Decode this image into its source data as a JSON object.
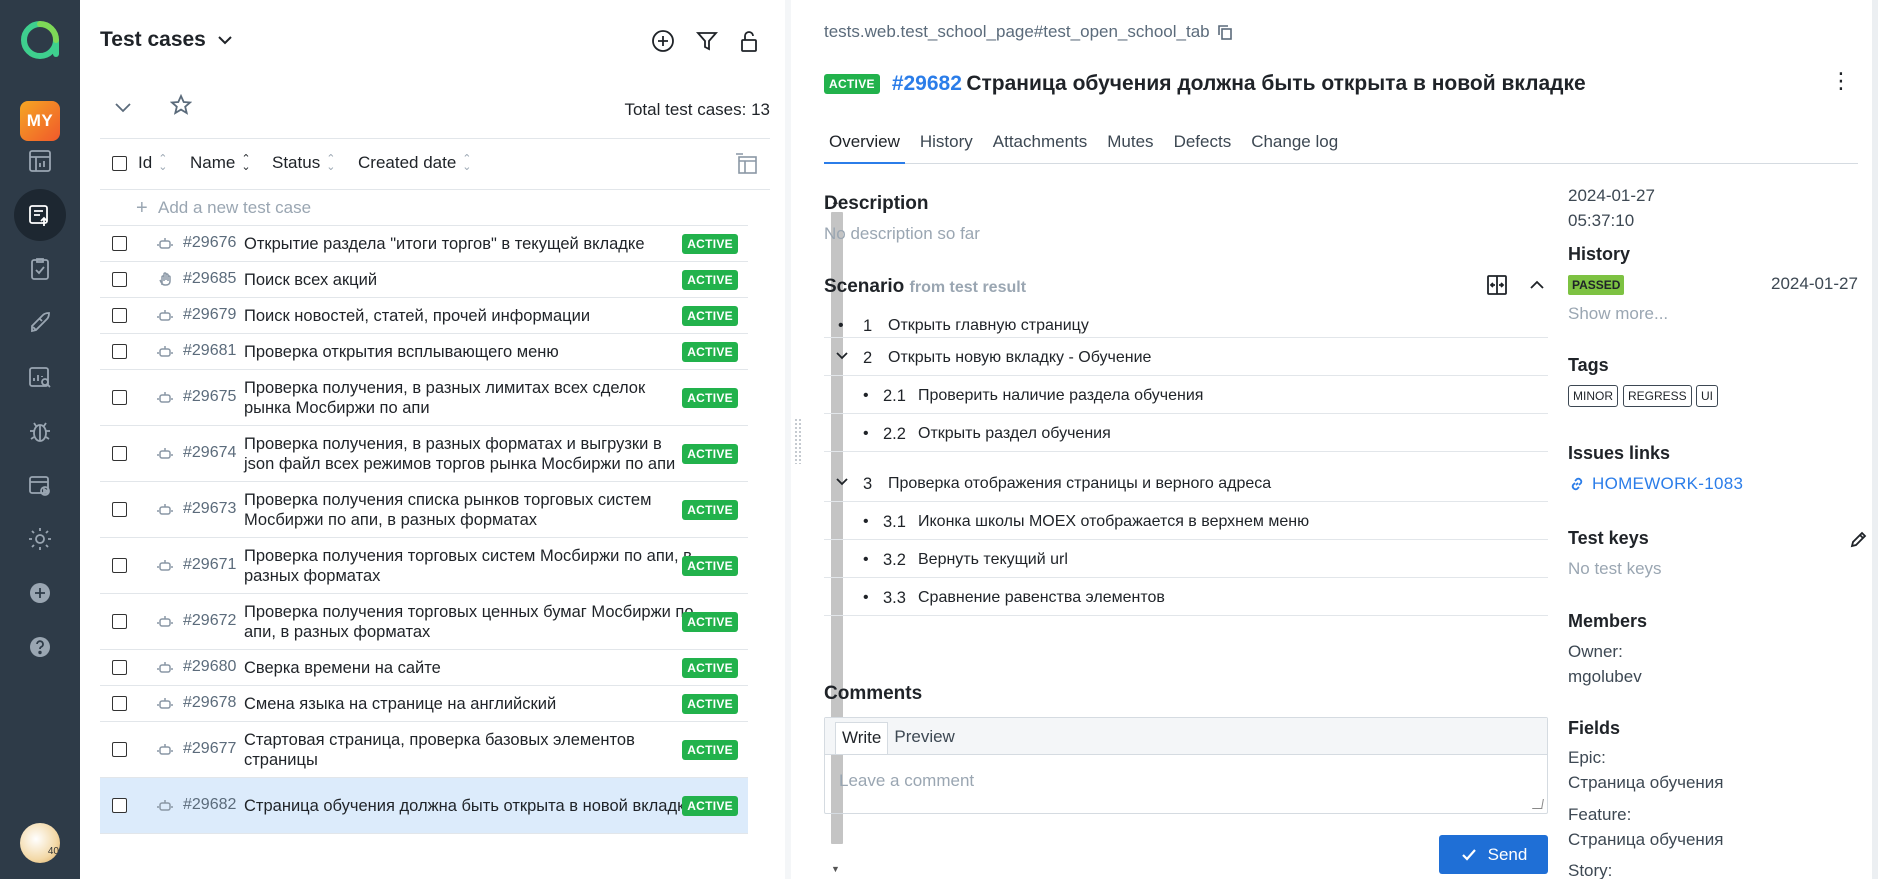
{
  "nav": {
    "my_label": "MY",
    "items": [
      {
        "icon": "dashboard-icon"
      },
      {
        "icon": "test-cases-icon",
        "active": true
      },
      {
        "icon": "test-plans-icon"
      },
      {
        "icon": "launches-icon"
      },
      {
        "icon": "analytics-icon"
      },
      {
        "icon": "defects-icon"
      },
      {
        "icon": "jobs-icon"
      },
      {
        "icon": "settings-icon"
      },
      {
        "icon": "add-project-icon"
      },
      {
        "icon": "help-icon"
      }
    ],
    "avatar_badge": "40"
  },
  "list": {
    "title": "Test cases",
    "total_label": "Total test cases: 13",
    "columns": [
      "Id",
      "Name",
      "Status",
      "Created date"
    ],
    "add_label": "Add a new test case",
    "rows": [
      {
        "id": "#29676",
        "name": "Открытие раздела \"итоги торгов\" в текущей вкладке",
        "status": "ACTIVE",
        "icon": "robot"
      },
      {
        "id": "#29685",
        "name": "Поиск всех акций",
        "status": "ACTIVE",
        "icon": "hand"
      },
      {
        "id": "#29679",
        "name": "Поиск новостей, статей, прочей информации",
        "status": "ACTIVE",
        "icon": "robot"
      },
      {
        "id": "#29681",
        "name": "Проверка открытия всплывающего меню",
        "status": "ACTIVE",
        "icon": "robot"
      },
      {
        "id": "#29675",
        "name": "Проверка получения, в разных лимитах всех сделок рынка Мосбиржи по апи",
        "status": "ACTIVE",
        "icon": "robot"
      },
      {
        "id": "#29674",
        "name": "Проверка получения, в разных форматах и выгрузки в json файл всех режимов торгов рынка Мосбиржи по апи",
        "status": "ACTIVE",
        "icon": "robot"
      },
      {
        "id": "#29673",
        "name": "Проверка получения списка рынков торговых систем Мосбиржи по апи, в разных форматах",
        "status": "ACTIVE",
        "icon": "robot"
      },
      {
        "id": "#29671",
        "name": "Проверка получения торговых систем Мосбиржи по апи, в разных форматах",
        "status": "ACTIVE",
        "icon": "robot"
      },
      {
        "id": "#29672",
        "name": "Проверка получения торговых ценных бумаг Мосбиржи по апи, в разных форматах",
        "status": "ACTIVE",
        "icon": "robot"
      },
      {
        "id": "#29680",
        "name": "Сверка времени на сайте",
        "status": "ACTIVE",
        "icon": "robot"
      },
      {
        "id": "#29678",
        "name": "Смена языка на странице на английский",
        "status": "ACTIVE",
        "icon": "robot"
      },
      {
        "id": "#29677",
        "name": "Стартовая страница, проверка базовых элементов страницы",
        "status": "ACTIVE",
        "icon": "robot"
      },
      {
        "id": "#29682",
        "name": "Страница обучения должна быть открыта в новой вкладке",
        "status": "ACTIVE",
        "icon": "robot",
        "selected": true
      }
    ]
  },
  "detail": {
    "path": "tests.web.test_school_page#test_open_school_tab",
    "status": "ACTIVE",
    "number": "#29682",
    "title": "Страница обучения должна быть открыта в новой вкладке",
    "tabs": [
      "Overview",
      "History",
      "Attachments",
      "Mutes",
      "Defects",
      "Change log"
    ],
    "description_h": "Description",
    "description": "No description so far",
    "scenario_h": "Scenario",
    "scenario_sub": "from test result",
    "steps": [
      {
        "n": "1",
        "text": "Открыть главную страницу",
        "level": 0,
        "marker": "bullet"
      },
      {
        "n": "2",
        "text": "Открыть новую вкладку - Обучение",
        "level": 0,
        "marker": "chevron"
      },
      {
        "n": "2.1",
        "text": "Проверить наличие раздела обучения",
        "level": 1,
        "marker": "bullet"
      },
      {
        "n": "2.2",
        "text": "Открыть раздел обучения",
        "level": 1,
        "marker": "bullet"
      },
      {
        "n": "3",
        "text": "Проверка отображения страницы и верного адреса",
        "level": 0,
        "marker": "chevron"
      },
      {
        "n": "3.1",
        "text": "Иконка школы MOEX отображается в верхнем меню",
        "level": 1,
        "marker": "bullet"
      },
      {
        "n": "3.2",
        "text": "Вернуть текущий url",
        "level": 1,
        "marker": "bullet"
      },
      {
        "n": "3.3",
        "text": "Сравнение равенства элементов",
        "level": 1,
        "marker": "bullet"
      }
    ],
    "comments_h": "Comments",
    "comment_tabs": [
      "Write",
      "Preview"
    ],
    "comment_placeholder": "Leave a comment",
    "send_label": "Send"
  },
  "side": {
    "created_date": "2024-01-27",
    "created_time": "05:37:10",
    "history_h": "History",
    "history_status": "PASSED",
    "history_date": "2024-01-27",
    "show_more": "Show more...",
    "tags_h": "Tags",
    "tags": [
      "MINOR",
      "REGRESS",
      "UI"
    ],
    "issues_h": "Issues links",
    "issue": "HOMEWORK-1083",
    "testkeys_h": "Test keys",
    "testkeys": "No test keys",
    "members_h": "Members",
    "owner_label": "Owner:",
    "owner": "mgolubev",
    "fields_h": "Fields",
    "epic_label": "Epic:",
    "epic": "Страница обучения",
    "feature_label": "Feature:",
    "feature": "Страница обучения",
    "story_label": "Story:"
  },
  "colors": {
    "accent": "#2b7de9",
    "nav_bg": "#2e3b48",
    "active_badge": "#22b24c",
    "passed": "#7dc242"
  }
}
